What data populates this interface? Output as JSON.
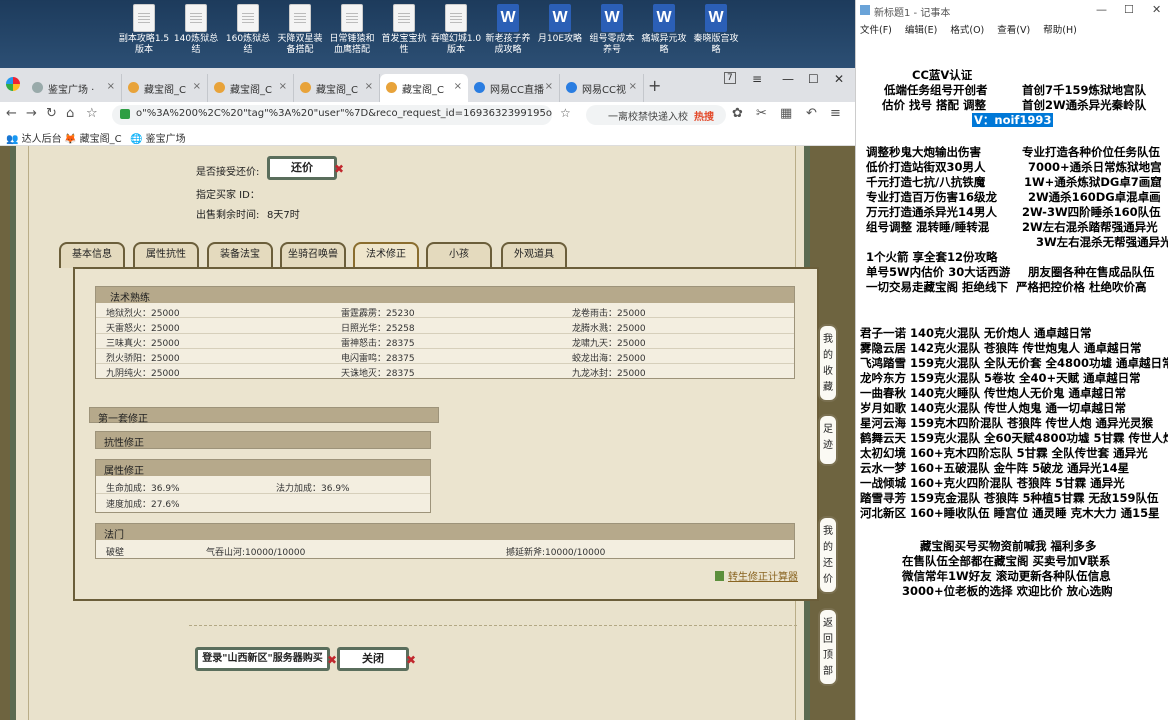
{
  "desktop": {
    "icons": [
      {
        "label": "副本攻略1.5版本",
        "type": "file"
      },
      {
        "label": "140炼狱总结",
        "type": "file"
      },
      {
        "label": "160炼狱总结",
        "type": "file"
      },
      {
        "label": "天降双星装备搭配",
        "type": "file"
      },
      {
        "label": "日常锤猿和血鹰搭配",
        "type": "file"
      },
      {
        "label": "首发宝宝抗性",
        "type": "file"
      },
      {
        "label": "吞噬幻城1.0版本",
        "type": "file"
      },
      {
        "label": "新老孩子养成攻略",
        "type": "file"
      },
      {
        "label": "月10E攻略",
        "type": "word"
      },
      {
        "label": "组号零成本养号",
        "type": "word"
      },
      {
        "label": "痛城异元攻略",
        "type": "word"
      },
      {
        "label": "秦晓版宫攻略",
        "type": "word"
      }
    ]
  },
  "browser": {
    "tabs": [
      {
        "label": "鉴宝广场 ·"
      },
      {
        "label": "藏宝阁_C"
      },
      {
        "label": "藏宝阁_C"
      },
      {
        "label": "藏宝阁_C"
      },
      {
        "label": "藏宝阁_C"
      },
      {
        "label": "网易CC直播"
      },
      {
        "label": "网易CC视"
      }
    ],
    "tab_counter": "7",
    "url": "o\"%3A%200%2C%20\"tag\"%3A%20\"user\"%7D&reco_request_id=1693632399195oXIQg",
    "search_text": "一离校禁快递入校",
    "search_hot": "热搜",
    "bookmarks": [
      "达人后台",
      "藏宝阁_C",
      "鉴宝广场"
    ]
  },
  "game": {
    "fields": {
      "accept_bargain_label": "是否接受还价:",
      "bargain_button": "还价",
      "buyer_label": "指定买家 ID：",
      "time_label": "出售剩余时间:",
      "time_value": "8天7时"
    },
    "tabs": [
      "基本信息",
      "属性抗性",
      "装备法宝",
      "坐骑召唤兽",
      "法术修正",
      "小孩",
      "外观道具"
    ],
    "spell_box": {
      "title": "法术熟练",
      "rows": [
        [
          "地狱烈火：25000",
          "雷霆霹雳：25230",
          "龙卷雨击：25000"
        ],
        [
          "天雷怒火：25000",
          "日照光华：25258",
          "龙腾水溅：25000"
        ],
        [
          "三味真火：25000",
          "雷神怒击：28375",
          "龙啸九天：25000"
        ],
        [
          "烈火骄阳：25000",
          "电闪雷鸣：28375",
          "蛟龙出海：25000"
        ],
        [
          "九阴纯火：25000",
          "天诛地灭：28375",
          "九龙冰封：25000"
        ]
      ]
    },
    "modset_title": "第一套修正",
    "resist_title": "抗性修正",
    "attr_box": {
      "title": "属性修正",
      "rows": [
        [
          "生命加成：36.9%",
          "法力加成：36.9%"
        ],
        [
          "速度加成：27.6%",
          ""
        ]
      ]
    },
    "method_box": {
      "title": "法门",
      "items": [
        "破壁",
        "气吞山河:10000/10000",
        "撼延新斧:10000/10000"
      ]
    },
    "calc_link": "转生修正计算器",
    "login_button": "登录\"山西新区\"服务器购买",
    "close_button": "关闭",
    "side_buttons": [
      "我的收藏",
      "足迹",
      "我的还价",
      "返回顶部"
    ]
  },
  "notepad": {
    "title": "新标题1 - 记事本",
    "menu": [
      "文件(F)",
      "编辑(E)",
      "格式(O)",
      "查看(V)",
      "帮助(H)"
    ],
    "lines_top": [
      "CC蓝V认证",
      "低端任务组号开创者",
      "估价 找号 搭配 调整"
    ],
    "lines_top_right": [
      "首创7千159炼狱地宫队",
      "首创2W通杀异光秦岭队"
    ],
    "contact": "V：noif1993",
    "block2": [
      [
        "调整秒鬼大炮输出伤害",
        "专业打造各种价位任务队伍"
      ],
      [
        "低价打造站街双30男人",
        "7000+通杀日常炼狱地宫"
      ],
      [
        "千元打造七抗/八抗铁魔",
        "1W+通杀炼狱DG卓7画窟"
      ],
      [
        "专业打造百万伤害16级龙",
        "2W通杀160DG卓混卓画"
      ],
      [
        "万元打造通杀异光14男人",
        "2W-3W四阶睡杀160队伍"
      ],
      [
        "组号调整 混转睡/睡转混",
        "2W左右混杀踏帮强通异光"
      ],
      [
        "",
        "3W左右混杀无帮强通异光"
      ]
    ],
    "block3": [
      "1个火箭 享全套12份攻略",
      "单号5W内估价 30大话西游",
      "一切交易走藏宝阁 拒绝线下"
    ],
    "block3_right": [
      "朋友圈各种在售成品队伍",
      "严格把控价格 杜绝吹价高"
    ],
    "teams": [
      "君子一诺 140克火混队 无价炮人 通卓越日常",
      "雾隐云居 142克火混队 苍狼阵 传世炮鬼人 通卓越日常",
      "飞鸿踏雪 159克火混队 全队无价套 全4800功墟 通卓越日常",
      "龙吟东方 159克火混队 5卷妆 全40+天赋 通卓越日常",
      "一曲春秋 140克火睡队 传世炮人无价鬼 通卓越日常",
      "岁月如歌 140克火混队 传世人炮鬼 通一切卓越日常",
      "星河云海 159克木四阶混队 苍狼阵 传世人炮 通异光灵猴",
      "鹤舞云天 159克火混队 全60天赋4800功墟 5甘霖 传世人炮",
      "太初幻境 160+克木四阶忘队 5甘霖 全队传世套 通异光",
      "云水一梦 160+五破混队 金牛阵 5破龙 通异光14星",
      "一战倾城 160+克火四阶混队 苍狼阵 5甘霖 通异光",
      "踏雪寻芳 159克金混队 苍狼阵 5种植5甘霖 无敌159队伍",
      "河北新区 160+睡收队伍 睡宫位 通灵睡 克木大力 通15星"
    ],
    "footer": [
      "藏宝阁买号买物资前喊我 福利多多",
      "在售队伍全部都在藏宝阁 买卖号加V联系",
      "微信常年1W好友 滚动更新各种队伍信息",
      "3000+位老板的选择 欢迎比价 放心选购"
    ]
  }
}
